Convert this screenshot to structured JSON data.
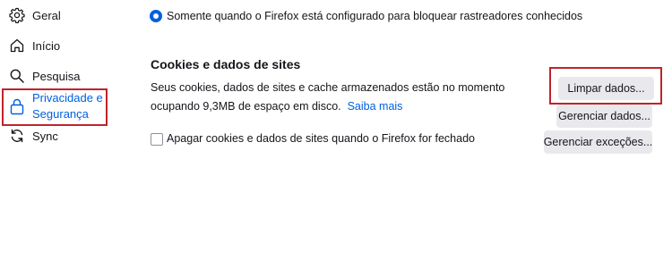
{
  "sidebar": {
    "items": [
      {
        "label": "Geral",
        "icon": "gear-icon"
      },
      {
        "label": "Início",
        "icon": "home-icon"
      },
      {
        "label": "Pesquisa",
        "icon": "search-icon"
      },
      {
        "label": "Privacidade e Segurança",
        "icon": "lock-icon",
        "selected": true
      },
      {
        "label": "Sync",
        "icon": "sync-icon"
      }
    ]
  },
  "tracking": {
    "radio_label": "Somente quando o Firefox está configurado para bloquear rastreadores conhecidos",
    "selected": true
  },
  "cookies": {
    "heading": "Cookies e dados de sites",
    "description": "Seus cookies, dados de sites e cache armazenados estão no momento ocupando 9,3MB de espaço em disco.",
    "learn_more": "Saiba mais",
    "checkbox_label": "Apagar cookies e dados de sites quando o Firefox for fechado",
    "checkbox_checked": false,
    "buttons": {
      "clear": "Limpar dados...",
      "manage": "Gerenciar dados...",
      "exceptions": "Gerenciar exceções..."
    }
  },
  "colors": {
    "accent": "#0061e0",
    "highlight_border": "#c0232a",
    "button_bg": "#e9e9ed"
  }
}
